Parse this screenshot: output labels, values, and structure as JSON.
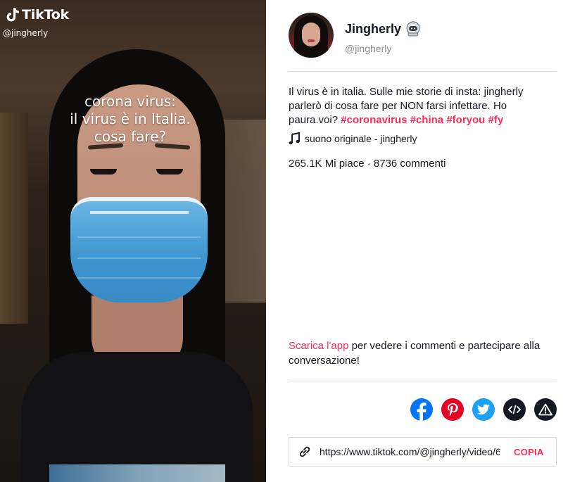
{
  "video": {
    "brand_name": "TikTok",
    "handle": "@jingherly",
    "overlay_lines": [
      "corona virus:",
      "il virus è in Italia.",
      "cosa fare?"
    ]
  },
  "profile": {
    "display_name": "Jingherly",
    "username": "@jingherly",
    "badge_icon": "astronaut-emoji-icon"
  },
  "caption": {
    "text": "Il virus è in italia. Sulle mie storie di insta: jingherly parlerò di cosa fare per NON farsi infettare. Ho paura.voi?",
    "hashtags": [
      "#coronavirus",
      "#china",
      "#foryou",
      "#fy"
    ]
  },
  "music": {
    "icon": "music-note-icon",
    "label": "suono originale - jingherly"
  },
  "stats": {
    "text": "265.1K Mi piace · 8736 commenti"
  },
  "download_prompt": {
    "link_label": "Scarica l'app",
    "text": " per vedere i commenti e partecipare alla conversazione!"
  },
  "share": {
    "buttons": [
      {
        "name": "facebook",
        "icon": "facebook-icon",
        "color": "#0075fa"
      },
      {
        "name": "pinterest",
        "icon": "pinterest-icon",
        "color": "#e60023"
      },
      {
        "name": "twitter",
        "icon": "twitter-icon",
        "color": "#1da1f2"
      },
      {
        "name": "embed",
        "icon": "code-embed-icon",
        "color": "#161823"
      },
      {
        "name": "report",
        "icon": "warning-icon",
        "color": "#161823"
      }
    ]
  },
  "link": {
    "url": "https://www.tiktok.com/@jingherly/video/6797424012396072198",
    "copy_label": "COPIA"
  },
  "colors": {
    "accent": "#fe2c55",
    "text": "#161823",
    "muted": "#8a8b91"
  }
}
